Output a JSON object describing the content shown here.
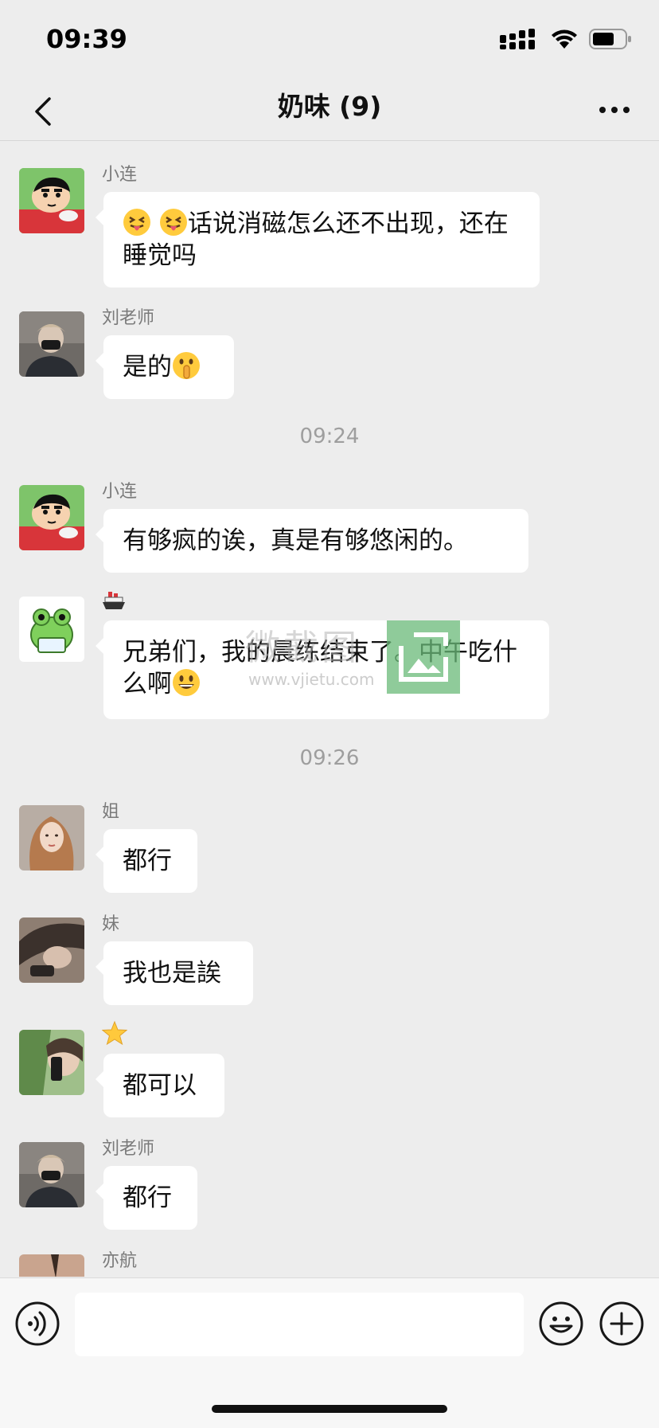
{
  "status_bar": {
    "time": "09:39"
  },
  "nav": {
    "title": "奶味 (9)"
  },
  "messages": [
    {
      "sender": "小连",
      "text_before": "",
      "text": "话说消磁怎么还不出现，还在睡觉吗",
      "emoji_before": [
        "squinting-tongue-face",
        "squinting-tongue-face"
      ]
    },
    {
      "sender": "刘老师",
      "text": "是的",
      "emoji_after": "shushing-face"
    },
    {
      "sender": "小连",
      "text": "有够疯的诶，真是有够悠闲的。"
    },
    {
      "sender_icon": "ship-icon",
      "text": "兄弟们，我的晨练结束了。中午吃什么啊",
      "emoji_after": "grinning-face"
    },
    {
      "sender": "姐",
      "text": "都行"
    },
    {
      "sender": "妹",
      "text": "我也是誒"
    },
    {
      "sender_icon": "star-icon",
      "text": "都可以"
    },
    {
      "sender": "刘老师",
      "text": "都行"
    },
    {
      "sender": "亦航"
    }
  ],
  "timestamps": [
    "09:24",
    "09:26"
  ],
  "watermark": {
    "text": "微截图",
    "url": "www.vjietu.com"
  },
  "input": {
    "value": "",
    "placeholder": ""
  },
  "colors": {
    "background": "#EDEDED",
    "bubble": "#FFFFFF",
    "sender": "#7A7A7A",
    "timestamp": "#9E9E9E"
  }
}
